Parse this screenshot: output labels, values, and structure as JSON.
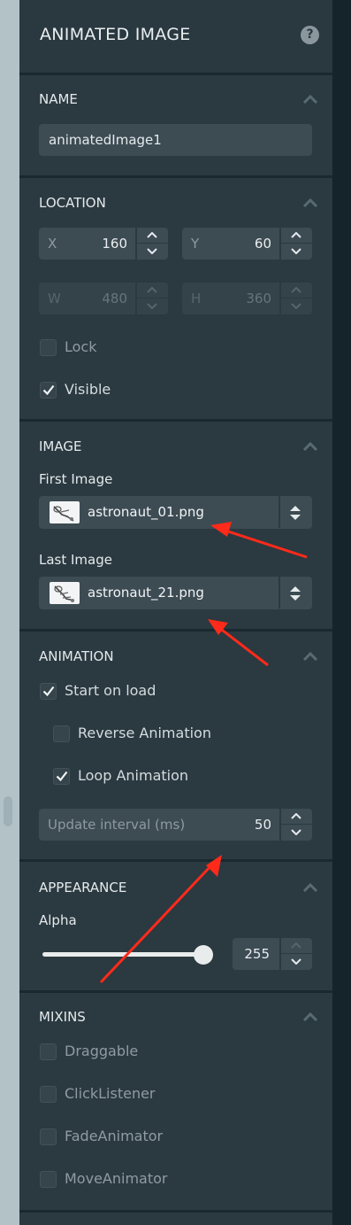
{
  "panel": {
    "title": "ANIMATED IMAGE",
    "help_icon": "question-circle-icon",
    "help_glyph": "?"
  },
  "sections": {
    "name": {
      "title": "NAME",
      "value": "animatedImage1"
    },
    "location": {
      "title": "LOCATION",
      "x": {
        "label": "X",
        "value": "160"
      },
      "y": {
        "label": "Y",
        "value": "60"
      },
      "w": {
        "label": "W",
        "value": "480"
      },
      "h": {
        "label": "H",
        "value": "360"
      },
      "lock": {
        "label": "Lock",
        "checked": false
      },
      "visible": {
        "label": "Visible",
        "checked": true
      }
    },
    "image": {
      "title": "IMAGE",
      "first_label": "First Image",
      "first_value": "astronaut_01.png",
      "last_label": "Last Image",
      "last_value": "astronaut_21.png"
    },
    "animation": {
      "title": "ANIMATION",
      "start_on_load": {
        "label": "Start on load",
        "checked": true
      },
      "reverse": {
        "label": "Reverse Animation",
        "checked": false
      },
      "loop": {
        "label": "Loop Animation",
        "checked": true
      },
      "interval_label": "Update interval (ms)",
      "interval_value": "50"
    },
    "appearance": {
      "title": "APPEARANCE",
      "alpha_label": "Alpha",
      "alpha_value": "255",
      "alpha_fraction": 1.0
    },
    "mixins": {
      "title": "MIXINS",
      "items": [
        {
          "label": "Draggable",
          "checked": false
        },
        {
          "label": "ClickListener",
          "checked": false
        },
        {
          "label": "FadeAnimator",
          "checked": false
        },
        {
          "label": "MoveAnimator",
          "checked": false
        }
      ]
    }
  },
  "colors": {
    "panel_bg": "#2b3940",
    "field_bg": "#3d4b53",
    "annotation_arrow": "#ff2a1a"
  }
}
